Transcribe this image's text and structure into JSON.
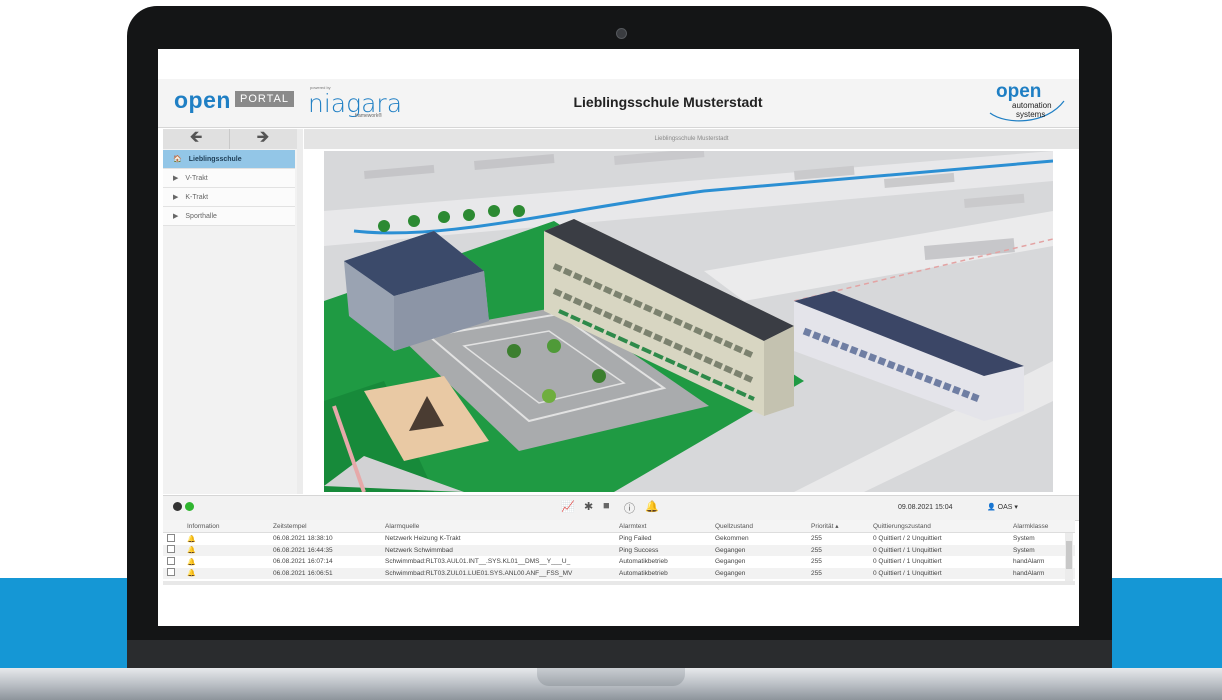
{
  "app": {
    "portal_logo": "open",
    "portal_tag": "PORTAL",
    "powered_by": "powered by",
    "niagara_logo": "niagara",
    "framework_label": "framework®",
    "page_title": "Lieblingsschule Musterstadt",
    "vendor_logo_main": "open",
    "vendor_logo_line1": "automation",
    "vendor_logo_line2": "systems"
  },
  "nav": {
    "back_glyph": "🡸",
    "forward_glyph": "🡺"
  },
  "tree": [
    {
      "label": "Lieblingsschule",
      "glyph": "🏠",
      "active": true
    },
    {
      "label": "V-Trakt",
      "glyph": "▶",
      "active": false
    },
    {
      "label": "K-Trakt",
      "glyph": "▶",
      "active": false
    },
    {
      "label": "Sporthalle",
      "glyph": "▶",
      "active": false
    }
  ],
  "breadcrumb": "Lieblingsschule Musterstadt",
  "statusbar": {
    "led_colors": [
      "#333333",
      "#2fb52f"
    ],
    "icons": [
      "chart-icon",
      "bug-icon",
      "note-icon",
      "info-icon",
      "bell-icon"
    ],
    "datetime": "09.08.2021 15:04",
    "user": "OAS ▾"
  },
  "alarm_table": {
    "headers": [
      "",
      "Information",
      "Zeitstempel",
      "Alarmquelle",
      "Alarmtext",
      "Quellzustand",
      "Priorität ▴",
      "Quittierungszustand",
      "Alarmklasse"
    ],
    "rows": [
      {
        "bell_color": "#e0302a",
        "zeit": "06.08.2021 18:38:10",
        "quelle": "Netzwerk Heizung K-Trakt",
        "text": "Ping Failed",
        "zustand": "Gekommen",
        "prio": "255",
        "quitt": "0 Quittiert / 2 Unquittiert",
        "klasse": "System"
      },
      {
        "bell_color": "#2fa84a",
        "zeit": "06.08.2021 16:44:35",
        "quelle": "Netzwerk Schwimmbad",
        "text": "Ping Success",
        "zustand": "Gegangen",
        "prio": "255",
        "quitt": "0 Quittiert / 1 Unquittiert",
        "klasse": "System"
      },
      {
        "bell_color": "#2fa84a",
        "zeit": "06.08.2021 16:07:14",
        "quelle": "Schwimmbad:RLT03.AUL01.INT__.SYS.KL01__DMS__Y___U_",
        "text": "Automatikbetrieb",
        "zustand": "Gegangen",
        "prio": "255",
        "quitt": "0 Quittiert / 1 Unquittiert",
        "klasse": "handAlarm"
      },
      {
        "bell_color": "#2fa84a",
        "zeit": "06.08.2021 16:06:51",
        "quelle": "Schwimmbad:RLT03.ZUL01.LUE01.SYS.ANL00.ANF__FSS_MV",
        "text": "Automatikbetrieb",
        "zustand": "Gegangen",
        "prio": "255",
        "quitt": "0 Quittiert / 1 Unquittiert",
        "klasse": "handAlarm"
      }
    ]
  },
  "colors": {
    "brand_blue": "#1f7fc4",
    "tree_active": "#93c6e7",
    "campus_lawn": "#1f9a43"
  }
}
